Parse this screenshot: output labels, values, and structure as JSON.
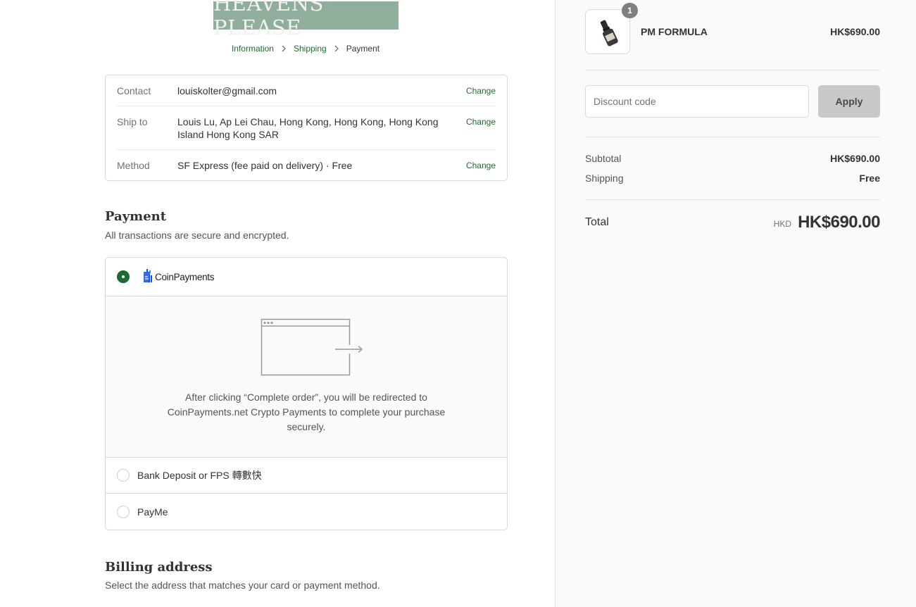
{
  "store": {
    "logo_text": "HEAVENS PLEASE"
  },
  "breadcrumb": {
    "items": [
      {
        "label": "Information"
      },
      {
        "label": "Shipping"
      },
      {
        "label": "Payment"
      }
    ]
  },
  "review": {
    "rows": [
      {
        "label": "Contact",
        "value": "louiskolter@gmail.com",
        "change": "Change"
      },
      {
        "label": "Ship to",
        "value": "Louis Lu, Ap Lei Chau, Hong Kong, Hong Kong, Hong Kong Island Hong Kong SAR",
        "change": "Change"
      },
      {
        "label": "Method",
        "value": "SF Express (fee paid on delivery)",
        "value_suffix": "Free",
        "separator": " · ",
        "change": "Change"
      }
    ]
  },
  "payment": {
    "title": "Payment",
    "subtitle": "All transactions are secure and encrypted.",
    "options": [
      {
        "label": "CoinPayments",
        "selected": true
      },
      {
        "label": "Bank Deposit or FPS 轉數快",
        "selected": false
      },
      {
        "label": "PayMe",
        "selected": false
      }
    ],
    "redirect_text": "After clicking “Complete order”, you will be redirected to CoinPayments.net Crypto Payments to complete your purchase securely."
  },
  "billing": {
    "title": "Billing address",
    "subtitle": "Select the address that matches your card or payment method."
  },
  "summary": {
    "product": {
      "name": "PM FORMULA",
      "price": "HK$690.00",
      "quantity": "1"
    },
    "discount": {
      "placeholder": "Discount code",
      "apply_label": "Apply"
    },
    "subtotal_label": "Subtotal",
    "subtotal_value": "HK$690.00",
    "shipping_label": "Shipping",
    "shipping_value": "Free",
    "total_label": "Total",
    "total_currency": "HKD",
    "total_value": "HK$690.00"
  },
  "colors": {
    "accent": "#1d6b2f",
    "logo_bg": "#8fae9c",
    "sidebar_bg": "#fafafa",
    "apply_bg": "#c8c8c8"
  }
}
